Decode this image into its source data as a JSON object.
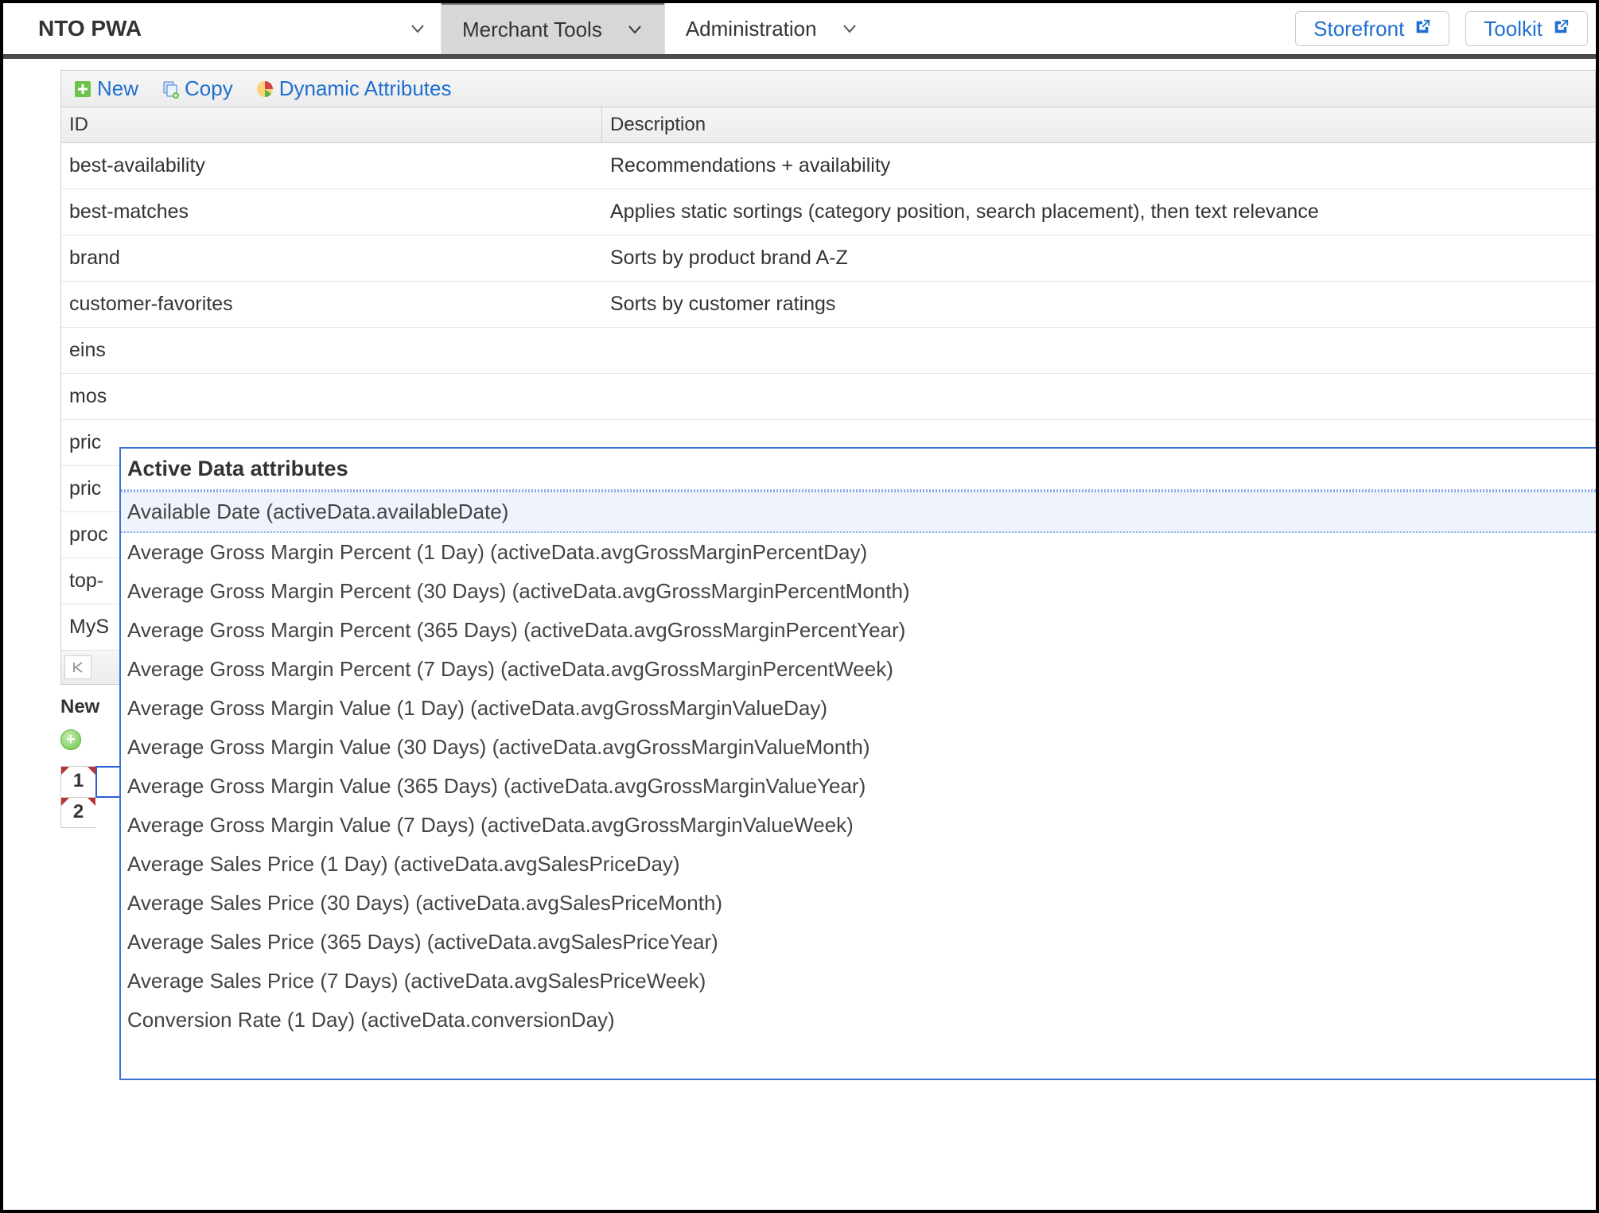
{
  "topnav": {
    "site": "NTO PWA",
    "tabs": [
      {
        "label": "Merchant Tools",
        "active": true
      },
      {
        "label": "Administration",
        "active": false
      }
    ],
    "links": [
      {
        "label": "Storefront"
      },
      {
        "label": "Toolkit"
      }
    ]
  },
  "toolbar": {
    "new_label": "New",
    "copy_label": "Copy",
    "dyn_label": "Dynamic Attributes"
  },
  "grid": {
    "headers": {
      "id": "ID",
      "desc": "Description"
    },
    "rows": [
      {
        "id": "best-availability",
        "desc": "Recommendations + availability"
      },
      {
        "id": "best-matches",
        "desc": "Applies static sortings (category position, search placement), then text relevance"
      },
      {
        "id": "brand",
        "desc": "Sorts by product brand A-Z"
      },
      {
        "id": "customer-favorites",
        "desc": "Sorts by customer ratings"
      }
    ],
    "partial_rows": [
      {
        "id": "eins"
      },
      {
        "id": "mos"
      },
      {
        "id": "pric"
      },
      {
        "id": "pric"
      },
      {
        "id": "proc"
      },
      {
        "id": "top-"
      },
      {
        "id": "MyS"
      }
    ]
  },
  "newrule_label": "New",
  "fx": {
    "row1": "1",
    "row2": "2",
    "input_value": ""
  },
  "dropdown": {
    "heading": "Active Data attributes",
    "items": [
      "Available Date (activeData.availableDate)",
      "Average Gross Margin Percent (1 Day) (activeData.avgGrossMarginPercentDay)",
      "Average Gross Margin Percent (30 Days) (activeData.avgGrossMarginPercentMonth)",
      "Average Gross Margin Percent (365 Days) (activeData.avgGrossMarginPercentYear)",
      "Average Gross Margin Percent (7 Days) (activeData.avgGrossMarginPercentWeek)",
      "Average Gross Margin Value (1 Day) (activeData.avgGrossMarginValueDay)",
      "Average Gross Margin Value (30 Days) (activeData.avgGrossMarginValueMonth)",
      "Average Gross Margin Value (365 Days) (activeData.avgGrossMarginValueYear)",
      "Average Gross Margin Value (7 Days) (activeData.avgGrossMarginValueWeek)",
      "Average Sales Price (1 Day) (activeData.avgSalesPriceDay)",
      "Average Sales Price (30 Days) (activeData.avgSalesPriceMonth)",
      "Average Sales Price (365 Days) (activeData.avgSalesPriceYear)",
      "Average Sales Price (7 Days) (activeData.avgSalesPriceWeek)",
      "Conversion Rate (1 Day) (activeData.conversionDay)"
    ]
  }
}
